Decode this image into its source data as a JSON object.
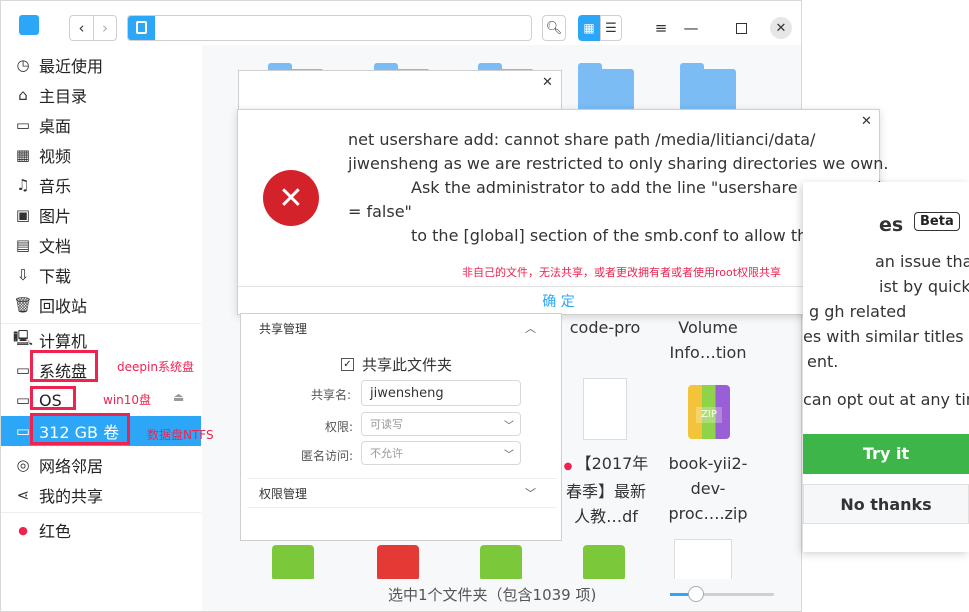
{
  "title_bar": {
    "path_icon": "hard-drive-icon"
  },
  "sidebar": {
    "items": [
      {
        "label": "最近使用",
        "icon": "clock-icon"
      },
      {
        "label": "主目录",
        "icon": "home-icon"
      },
      {
        "label": "桌面",
        "icon": "desktop-icon"
      },
      {
        "label": "视频",
        "icon": "film-icon"
      },
      {
        "label": "音乐",
        "icon": "music-icon"
      },
      {
        "label": "图片",
        "icon": "image-icon"
      },
      {
        "label": "文档",
        "icon": "document-icon"
      },
      {
        "label": "下载",
        "icon": "download-icon"
      },
      {
        "label": "回收站",
        "icon": "trash-icon"
      },
      {
        "label": "计算机",
        "icon": "computer-icon"
      },
      {
        "label": "系统盘",
        "icon": "disk-icon"
      },
      {
        "label": "OS",
        "icon": "disk-icon"
      },
      {
        "label": "312 GB 卷",
        "icon": "disk-icon"
      },
      {
        "label": "网络邻居",
        "icon": "network-icon"
      },
      {
        "label": "我的共享",
        "icon": "share-icon"
      },
      {
        "label": "红色",
        "icon": "red-tag-icon"
      }
    ],
    "annotations": {
      "system_disk": "deepin系统盘",
      "os_disk": "win10盘",
      "data_disk": "数据盘NTFS"
    }
  },
  "error_dialog": {
    "line1": "net usershare add: cannot share path /media/litianci/data/",
    "line2": "jiwensheng as we are restricted to only sharing directories we own.",
    "line3": "Ask the administrator to add the line \"usershare owner only",
    "line4": "= false\"",
    "line5": "to the [global] section of the smb.conf to allow this.",
    "note": "非自己的文件，无法共享，或者更改拥有者或者使用root权限共享",
    "confirm": "确 定"
  },
  "share_panel": {
    "section_share": "共享管理",
    "share_checkbox": "共享此文件夹",
    "share_name_label": "共享名:",
    "share_name_value": "jiwensheng",
    "permission_label": "权限:",
    "permission_value": "可读写",
    "anonymous_label": "匿名访问:",
    "anonymous_value": "不允许",
    "section_permission": "权限管理"
  },
  "files": {
    "code_pro": "code-pro",
    "volume_line1": "Volume",
    "volume_line2": "Info…tion",
    "pdf_line1": "【2017年",
    "pdf_line2": "春季】最新",
    "pdf_line3": "人教…df",
    "zip_line1": "book-yii2-",
    "zip_line2": "dev-",
    "zip_line3": "proc….zip",
    "zip_badge": "ZIP"
  },
  "status": {
    "text": "选中1个文件夹（包含1039 项)"
  },
  "popup": {
    "heading": "es",
    "badge": "Beta",
    "line1": "an issue that",
    "line2": "ist by quickly",
    "line3": "g  gh related",
    "line4": "es with similar titles and",
    "line5": "ent.",
    "line6": "can opt out at any time.",
    "try_it": "Try it",
    "no_thanks": "No thanks"
  },
  "colors": {
    "accent": "#2ca7f8",
    "error": "#d3222a",
    "annotation": "#ee2350",
    "try_green": "#3eb548"
  }
}
